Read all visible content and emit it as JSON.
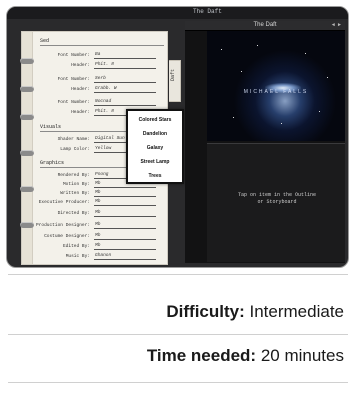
{
  "app_title": "The Daft",
  "notebook": {
    "tab_label": "Daft",
    "sections": [
      {
        "title": "Sed",
        "rows": [
          {
            "label": "Font Number:",
            "value": "Ba"
          },
          {
            "label": "Header:",
            "value": "Phit. 8"
          },
          {
            "label": "Font Number:",
            "value": "Serb"
          },
          {
            "label": "Header:",
            "value": "Grabb. W"
          },
          {
            "label": "Font Number:",
            "value": "Nocnad"
          },
          {
            "label": "Header:",
            "value": "Phit. 8"
          }
        ]
      },
      {
        "title": "Visuals",
        "rows": [
          {
            "label": "Shader Name:",
            "value": "Digital Sun"
          },
          {
            "label": "Lamp Color:",
            "value": "Yellow"
          }
        ]
      },
      {
        "title": "Graphics",
        "rows": [
          {
            "label": "Rendered By:",
            "value": "Pnong"
          },
          {
            "label": "Motion By:",
            "value": "Mb"
          },
          {
            "label": "Written By:",
            "value": "Mb"
          },
          {
            "label": "Executive Producer:",
            "value": "Mb"
          },
          {
            "label": "Directed By:",
            "value": "Mb"
          },
          {
            "label": "Production Designer:",
            "value": "Mb"
          },
          {
            "label": "Costume Designer:",
            "value": "Mb"
          },
          {
            "label": "Edited By:",
            "value": "Mb"
          },
          {
            "label": "Music By:",
            "value": "Ghanon"
          }
        ]
      }
    ]
  },
  "popup_menu": {
    "items": [
      "Colored Stars",
      "Dandelion",
      "Galaxy",
      "Street Lamp",
      "Trees"
    ]
  },
  "viewer": {
    "title": "The Daft",
    "controls": "◄ ►",
    "galaxy_text": "MICHAEL FALLS",
    "bottom_text": "Tap on item in the Outline or Storyboard"
  },
  "info": {
    "difficulty_label": "Difficulty:",
    "difficulty_value": "Intermediate",
    "time_label": "Time needed:",
    "time_value": "20 minutes"
  }
}
